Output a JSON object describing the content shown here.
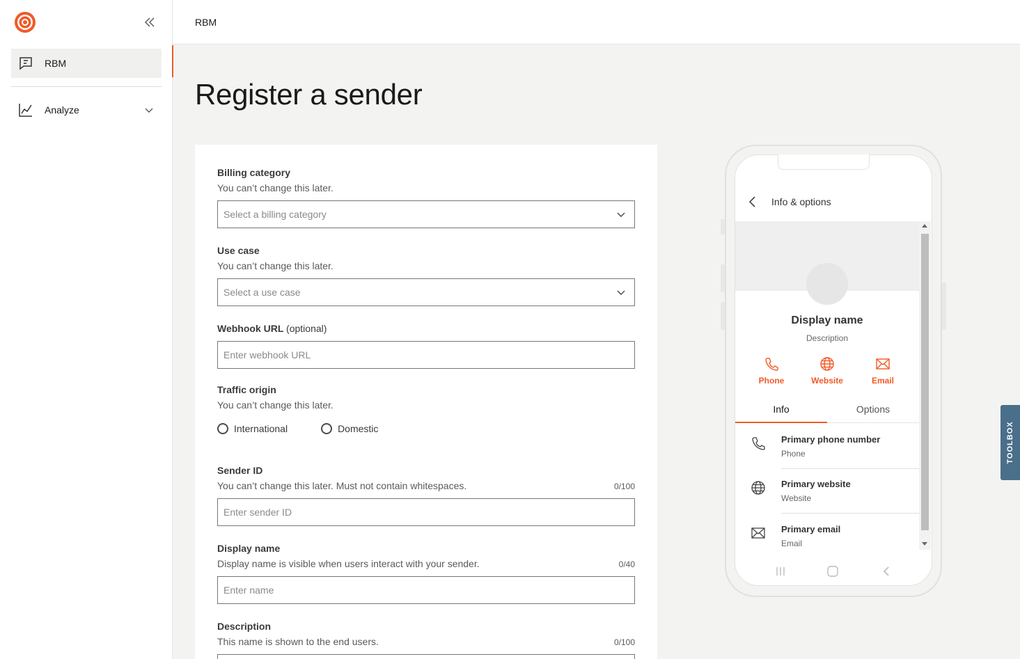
{
  "sidebar": {
    "items": [
      {
        "label": "RBM",
        "icon": "message-square-icon",
        "active": true
      },
      {
        "label": "Analyze",
        "icon": "chart-line-icon",
        "active": false
      }
    ],
    "collapse_icon": "double-chevron-left-icon",
    "accent_color": "#f05a28"
  },
  "topbar": {
    "breadcrumb": "RBM"
  },
  "page": {
    "title": "Register a sender"
  },
  "form": {
    "billing": {
      "label": "Billing category",
      "help": "You can’t change this later.",
      "placeholder": "Select a billing category"
    },
    "use_case": {
      "label": "Use case",
      "help": "You can’t change this later.",
      "placeholder": "Select a use case"
    },
    "webhook": {
      "label": "Webhook URL",
      "optional": "(optional)",
      "placeholder": "Enter webhook URL"
    },
    "traffic": {
      "label": "Traffic origin",
      "help": "You can’t change this later.",
      "options": [
        "International",
        "Domestic"
      ]
    },
    "sender_id": {
      "label": "Sender ID",
      "help": "You can’t change this later. Must not contain whitespaces.",
      "count": "0/100",
      "placeholder": "Enter sender ID"
    },
    "display_name": {
      "label": "Display name",
      "help": "Display name is visible when users interact with your sender.",
      "count": "0/40",
      "placeholder": "Enter name"
    },
    "description": {
      "label": "Description",
      "help": "This name is shown to the end users.",
      "count": "0/100"
    }
  },
  "preview": {
    "header_title": "Info & options",
    "display_name": "Display name",
    "description": "Description",
    "actions": [
      {
        "label": "Phone",
        "icon": "phone-icon"
      },
      {
        "label": "Website",
        "icon": "globe-icon"
      },
      {
        "label": "Email",
        "icon": "mail-icon"
      }
    ],
    "tabs": [
      "Info",
      "Options"
    ],
    "rows": [
      {
        "title": "Primary phone number",
        "sub": "Phone",
        "icon": "phone-icon"
      },
      {
        "title": "Primary website",
        "sub": "Website",
        "icon": "globe-icon"
      },
      {
        "title": "Primary email",
        "sub": "Email",
        "icon": "mail-icon"
      }
    ]
  },
  "toolbox": {
    "label": "TOOLBOX",
    "color": "#4a6f8a"
  }
}
